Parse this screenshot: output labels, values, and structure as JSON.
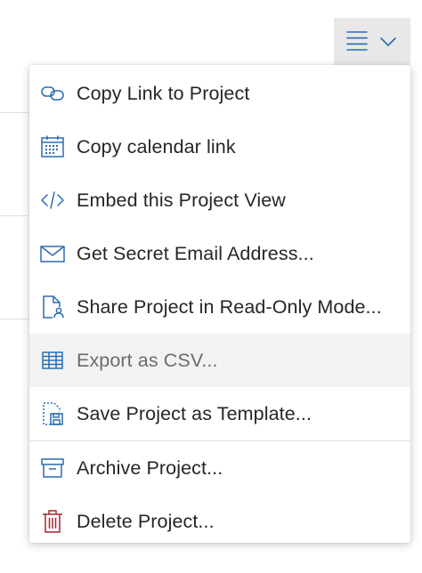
{
  "colors": {
    "icon_blue": "#2b6cb0",
    "delete_red": "#a4262c",
    "highlight_bg": "#f2f2f2",
    "toggle_bg": "#e8e8e8",
    "text": "#262626",
    "text_muted": "#6b6b6b"
  },
  "menu_toggle": {
    "icons": [
      "hamburger-icon",
      "chevron-down-icon"
    ]
  },
  "menu": {
    "items": [
      {
        "label": "Copy Link to Project",
        "icon": "link-icon"
      },
      {
        "label": "Copy calendar link",
        "icon": "calendar-icon"
      },
      {
        "label": "Embed this Project View",
        "icon": "code-icon"
      },
      {
        "label": "Get Secret Email Address...",
        "icon": "envelope-icon"
      },
      {
        "label": "Share Project in Read-Only Mode...",
        "icon": "document-share-icon"
      },
      {
        "label": "Export as CSV...",
        "icon": "table-icon",
        "state": "hovered"
      },
      {
        "label": "Save Project as Template...",
        "icon": "save-template-icon"
      },
      {
        "label": "Archive Project...",
        "icon": "archive-icon"
      },
      {
        "label": "Delete Project...",
        "icon": "trash-icon"
      }
    ]
  }
}
